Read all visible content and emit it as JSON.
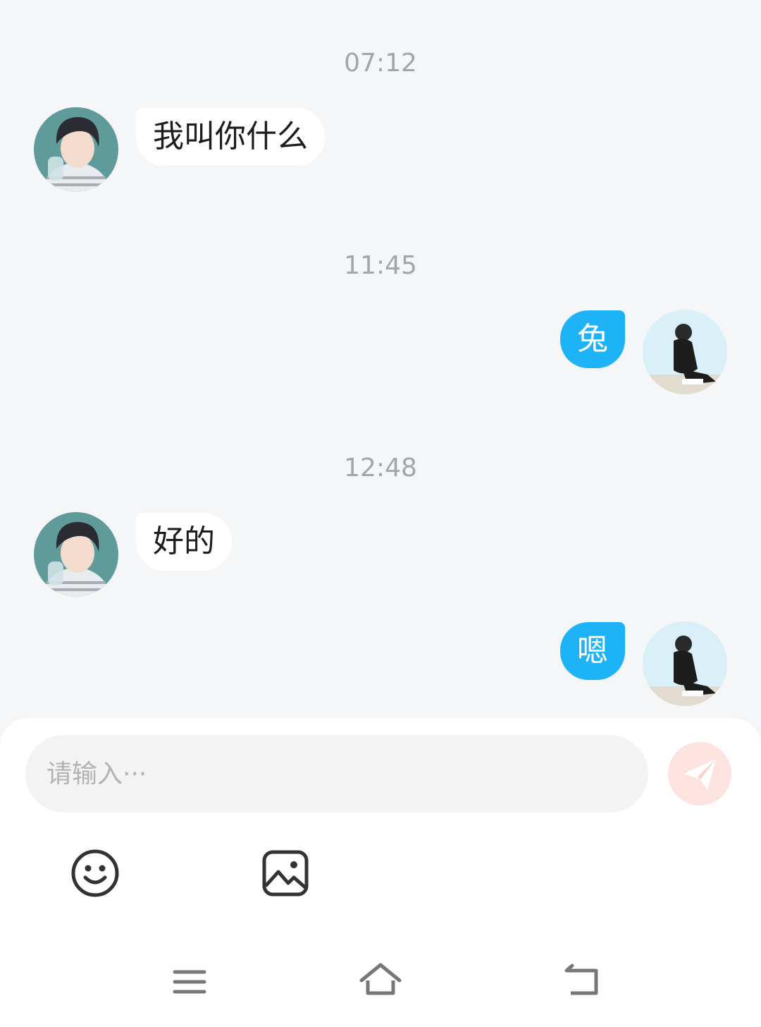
{
  "messages": [
    {
      "time": "07:12",
      "sender": "contact",
      "text": "我叫你什么"
    },
    {
      "time": "11:45",
      "sender": "self",
      "text": "兔"
    },
    {
      "time": "12:48",
      "sender": "contact",
      "text": "好的"
    },
    {
      "sender": "self",
      "text": "嗯"
    }
  ],
  "composer": {
    "placeholder": "请输入···",
    "send_icon": "send-paper-plane-icon",
    "tools": [
      "emoji-icon",
      "image-icon"
    ]
  },
  "nav_bar": {
    "icons": [
      "menu-icon",
      "home-icon",
      "back-icon"
    ]
  },
  "colors": {
    "background": "#f5f6f8",
    "outgoing_bubble": "#1eb3f7",
    "incoming_bubble": "#ffffff",
    "send_button": "#fde3e0",
    "timestamp": "#a3a5a8"
  }
}
